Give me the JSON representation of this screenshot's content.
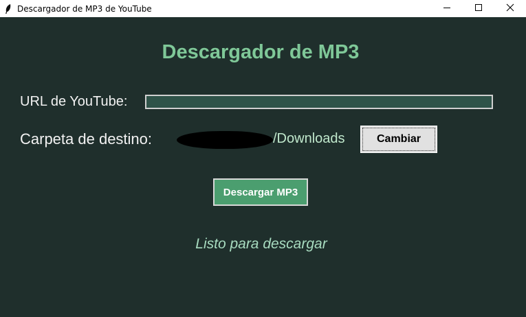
{
  "window": {
    "title": "Descargador de MP3 de YouTube",
    "controls": {
      "minimize": "minimize-icon",
      "maximize": "maximize-icon",
      "close": "close-icon"
    }
  },
  "main": {
    "heading": "Descargador de MP3",
    "url_label": "URL de YouTube:",
    "url_value": "",
    "folder_label": "Carpeta de destino:",
    "folder_path_suffix": "/Downloads",
    "change_button": "Cambiar",
    "download_button": "Descargar MP3",
    "status": "Listo para descargar"
  },
  "colors": {
    "background": "#1f2f2c",
    "heading": "#7fc898",
    "input_bg": "#2f5349",
    "download_button_bg": "#4b9e6f",
    "status_text": "#a8dcc0"
  }
}
